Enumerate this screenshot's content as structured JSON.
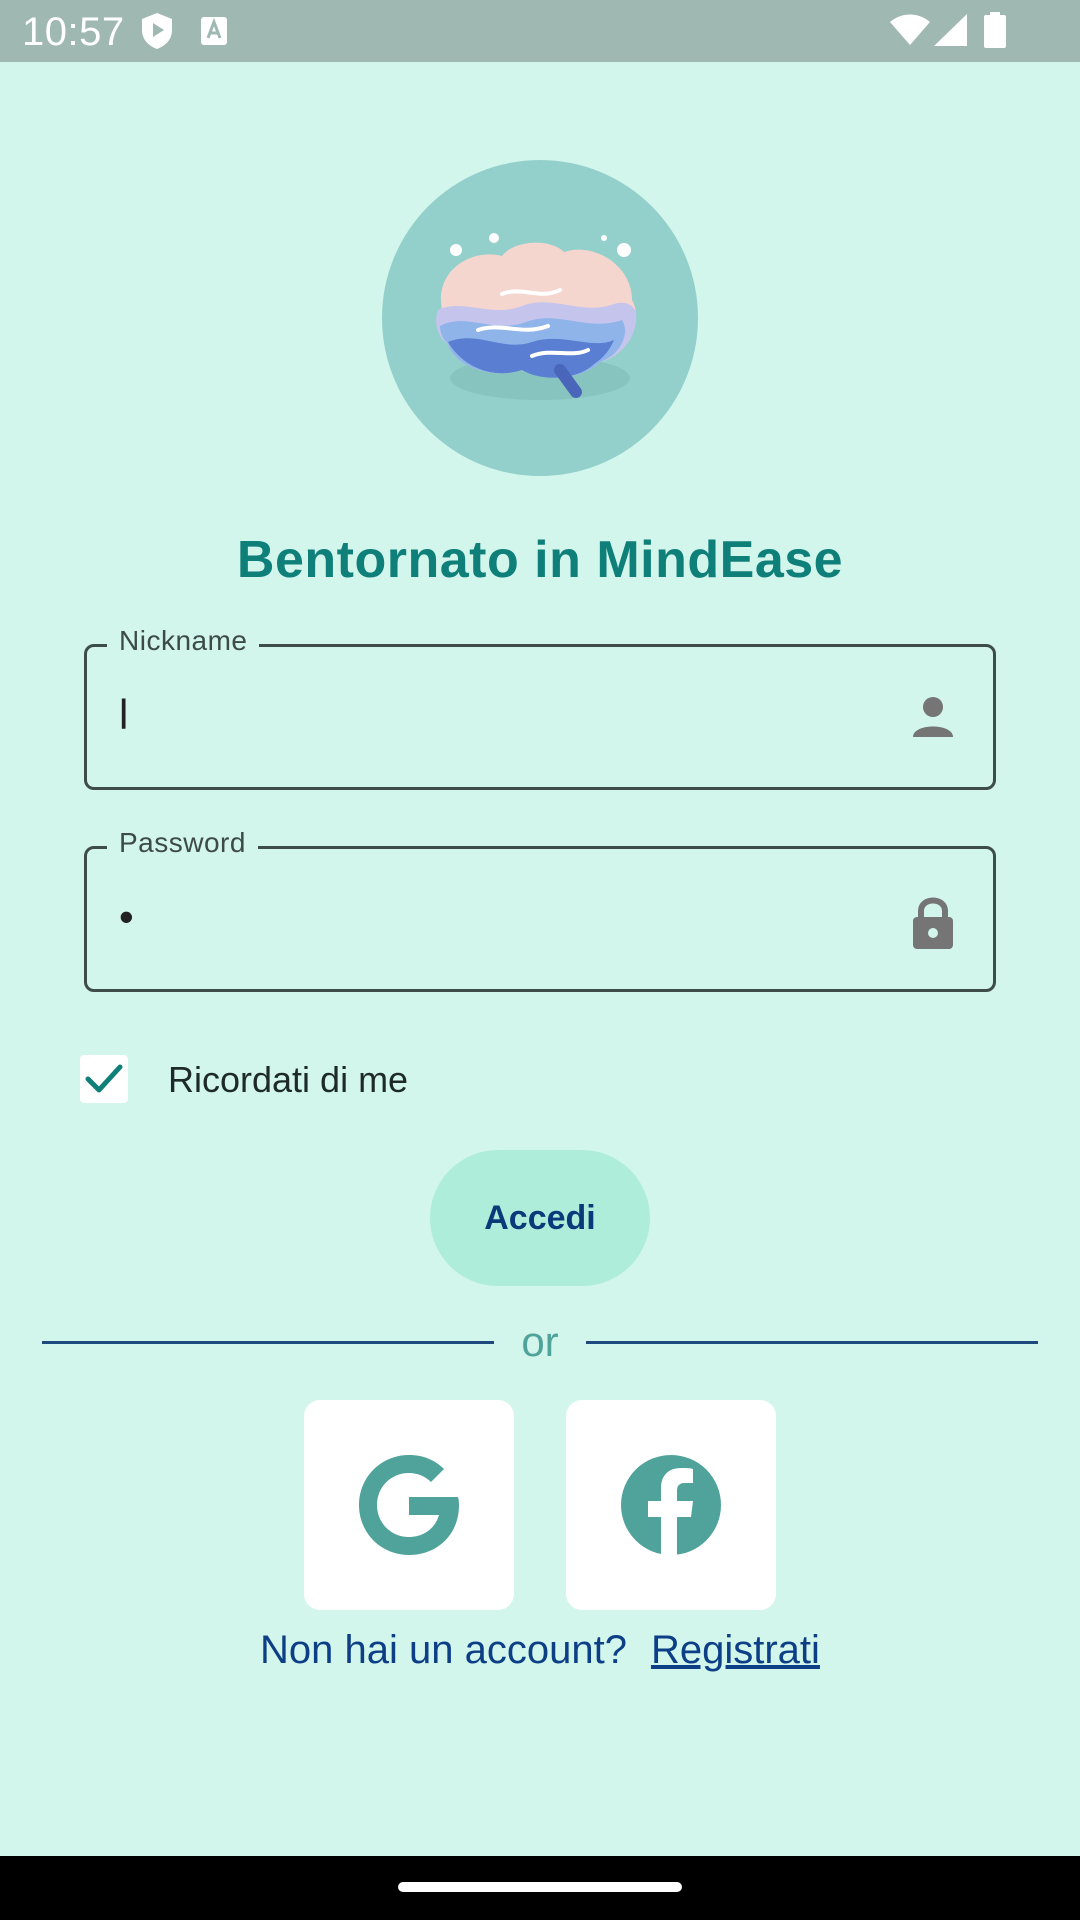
{
  "status_bar": {
    "time": "10:57"
  },
  "app": {
    "logo_icon": "brain-logo-icon",
    "title": "Bentornato in MindEase"
  },
  "form": {
    "nickname": {
      "label": "Nickname",
      "value": "l",
      "icon": "person-icon"
    },
    "password": {
      "label": "Password",
      "value": "•",
      "icon": "lock-icon"
    },
    "remember_me": {
      "label": "Ricordati di me",
      "checked": true
    }
  },
  "login_button": {
    "label": "Accedi"
  },
  "divider_text": "or",
  "social": [
    {
      "name": "google",
      "icon": "google-icon"
    },
    {
      "name": "facebook",
      "icon": "facebook-icon"
    }
  ],
  "signup": {
    "question": "Non hai un account?",
    "link": "Registrati"
  },
  "colors": {
    "background": "#d2f5ec",
    "accent": "#0e7f79",
    "button": "#aeedd9",
    "link": "#0d3f86",
    "social_icon": "#4fa39b"
  }
}
